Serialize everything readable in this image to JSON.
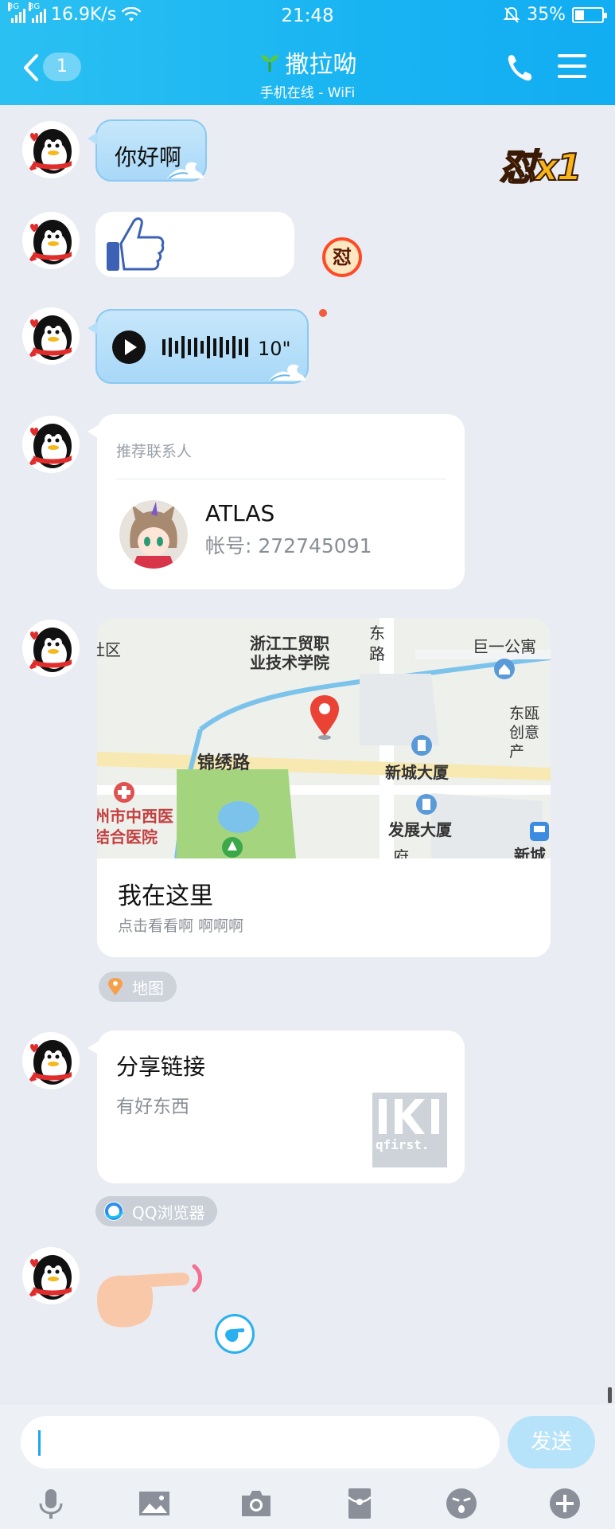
{
  "status_bar": {
    "network_1": "3G",
    "network_2": "3G",
    "speed": "16.9K/s",
    "time": "21:48",
    "battery": "35%",
    "battery_level": 0.35
  },
  "header": {
    "unread_count": "1",
    "contact_name": "撒拉呦",
    "presence": "手机在线 - WiFi",
    "colors": {
      "header": "#18b4f2",
      "accent": "#1aa7ef"
    }
  },
  "messages": {
    "greeting": "你好啊",
    "voice_duration": "10\"",
    "contact_card": {
      "label": "推荐联系人",
      "name": "ATLAS",
      "account": "帐号: 272745091"
    },
    "location": {
      "title": "我在这里",
      "subtitle": "点击看看啊 啊啊啊",
      "source": "地图",
      "map_labels": {
        "district": "社区",
        "college": "浙江工贸职业技术学院",
        "road_east": "东路",
        "apartment": "巨一公寓",
        "creative": "东瓯创意产",
        "road": "锦绣路",
        "building1": "新城大厦",
        "hospital": "州市中西医结合医院",
        "building2": "发展大厦",
        "newcity": "新城",
        "misc": "府"
      }
    },
    "link": {
      "title": "分享链接",
      "description": "有好东西",
      "source": "QQ浏览器",
      "thumb_text": "qfirst."
    }
  },
  "badges": {
    "combo": "怼x1",
    "small": "怼"
  },
  "input": {
    "send_label": "发送",
    "tools": [
      "microphone-icon",
      "image-icon",
      "camera-icon",
      "red-packet-icon",
      "emoji-icon",
      "plus-icon"
    ]
  }
}
